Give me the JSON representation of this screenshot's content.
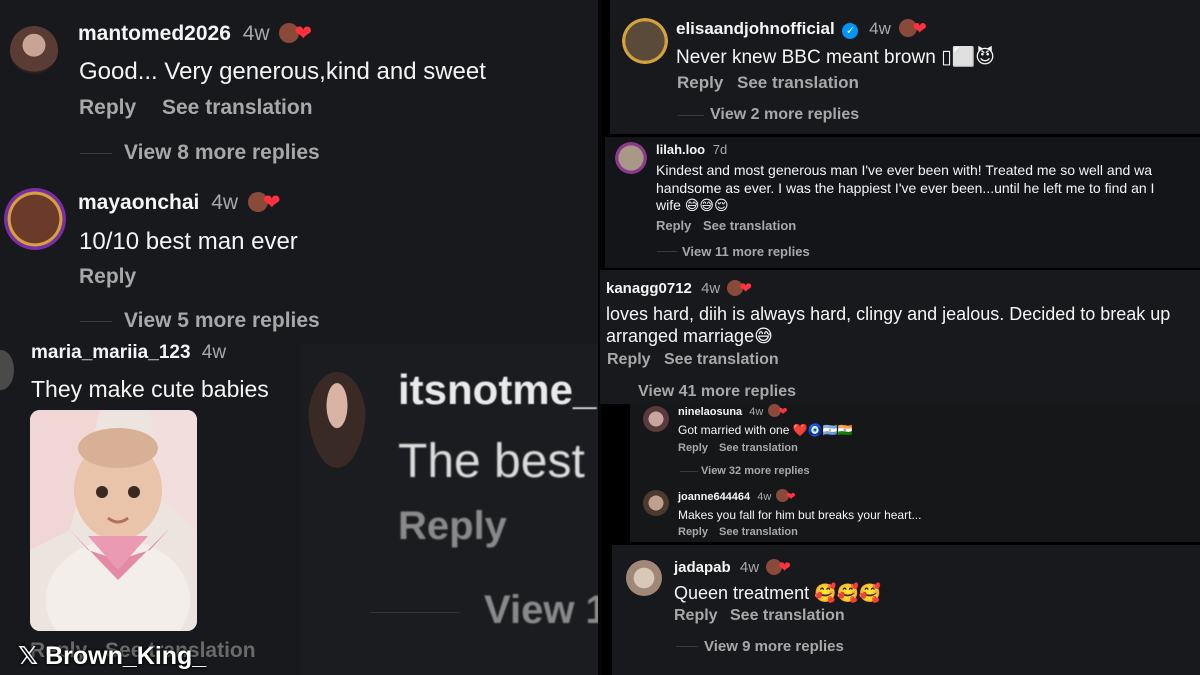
{
  "left": {
    "c1": {
      "user": "mantomed2026",
      "time": "4w",
      "text": "Good... Very generous,kind and sweet",
      "reply": "Reply",
      "translate": "See translation",
      "more": "View 8 more replies"
    },
    "c2": {
      "user": "mayaonchai",
      "time": "4w",
      "text": "10/10 best man ever",
      "reply": "Reply",
      "more": "View 5 more replies"
    },
    "c3": {
      "user": "maria_mariia_123",
      "time": "4w",
      "text": "They make cute babies",
      "reply_partial": "Reply",
      "translate_partial": "See translation"
    },
    "c4": {
      "user_partial": "itsnotme_",
      "text_partial": "The best",
      "reply": "Reply",
      "more_partial": "View 1"
    },
    "watermark": "𝕏 Brown_King_"
  },
  "right": {
    "r1": {
      "user": "elisaandjohnofficial",
      "time": "4w",
      "text": "Never knew BBC meant brown",
      "text_tail": "▯⬜😈",
      "reply": "Reply",
      "translate": "See translation",
      "more": "View 2 more replies"
    },
    "r2": {
      "user": "lilah.loo",
      "time": "7d",
      "line1": "Kindest and most generous man I've ever been with! Treated me so well and wa",
      "line2": "handsome as ever. I was the happiest I've ever been...until he left me to find an I",
      "line3": "wife 😅😅😌",
      "reply": "Reply",
      "translate": "See translation",
      "more": "View 11 more replies"
    },
    "r3": {
      "user": "kanagg0712",
      "time": "4w",
      "line1": "loves hard, diih is always hard,  clingy and jealous. Decided to break up",
      "line2": "arranged marriage😅",
      "reply": "Reply",
      "translate": "See translation",
      "more": "View 41 more replies"
    },
    "r4": {
      "user": "ninelaosuna",
      "time": "4w",
      "text": "Got married with one",
      "text_tail": "❤️🧿🇦🇷🇮🇳",
      "reply": "Reply",
      "translate": "See translation",
      "more": "View 32 more replies"
    },
    "r5": {
      "user": "joanne644464",
      "time": "4w",
      "text": "Makes you fall for him but breaks your heart...",
      "reply": "Reply",
      "translate": "See translation"
    },
    "r6": {
      "user": "jadapab",
      "time": "4w",
      "text": "Queen treatment",
      "text_tail": "🥰🥰🥰",
      "reply": "Reply",
      "translate": "See translation",
      "more": "View 9 more replies"
    }
  },
  "colors": {
    "background": "#16181c",
    "text": "#f5f5f5",
    "muted": "#a8a8a8",
    "heart": "#ff3040",
    "verified": "#0095f6"
  }
}
